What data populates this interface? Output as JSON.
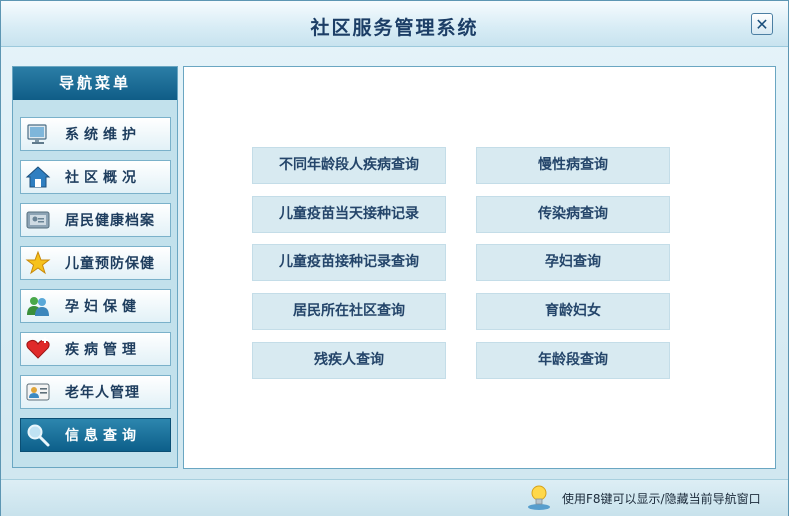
{
  "window": {
    "title": "社区服务管理系统",
    "close_glyph": "✕"
  },
  "sidebar": {
    "title": "导航菜单",
    "items": [
      {
        "label": "系统维护",
        "icon": "monitor-icon",
        "active": false
      },
      {
        "label": "社区概况",
        "icon": "home-icon",
        "active": false
      },
      {
        "label": "居民健康档案",
        "icon": "photo-id-icon",
        "active": false
      },
      {
        "label": "儿童预防保健",
        "icon": "star-icon",
        "active": false
      },
      {
        "label": "孕妇保健",
        "icon": "people-icon",
        "active": false
      },
      {
        "label": "疾病管理",
        "icon": "heart-icon",
        "active": false
      },
      {
        "label": "老年人管理",
        "icon": "id-card-icon",
        "active": false
      },
      {
        "label": "信息查询",
        "icon": "magnifier-icon",
        "active": true
      }
    ]
  },
  "queries": {
    "left": [
      "不同年龄段人疾病查询",
      "儿童疫苗当天接种记录",
      "儿童疫苗接种记录查询",
      "居民所在社区查询",
      "残疾人查询"
    ],
    "right": [
      "慢性病查询",
      "传染病查询",
      "孕妇查询",
      "育龄妇女",
      "年龄段查询"
    ]
  },
  "statusbar": {
    "hint": "使用F8键可以显示/隐藏当前导航窗口",
    "icon": "lightbulb-icon"
  },
  "colors": {
    "accent": "#0f5d87",
    "window_bg": "#d9ecf3",
    "button_bg": "#d8eaf1",
    "text_dark": "#1c3e66"
  }
}
